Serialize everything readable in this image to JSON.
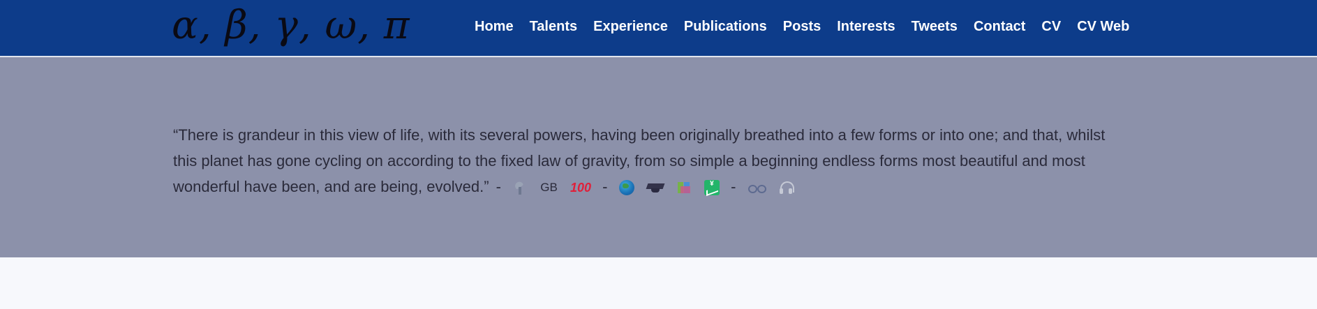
{
  "site": {
    "brand": "α, β, γ, ω, π"
  },
  "nav": {
    "items": [
      {
        "label": "Home"
      },
      {
        "label": "Talents"
      },
      {
        "label": "Experience"
      },
      {
        "label": "Publications"
      },
      {
        "label": "Posts"
      },
      {
        "label": "Interests"
      },
      {
        "label": "Tweets"
      },
      {
        "label": "Contact"
      },
      {
        "label": "CV"
      },
      {
        "label": "CV Web"
      }
    ]
  },
  "hero": {
    "quote": "“There is grandeur in this view of life, with its several powers, having been originally breathed into a few forms or into one; and that, whilst this planet has gone cycling on according to the fixed law of gravity, from so simple a beginning endless forms most beautiful and most wonderful have been, and are being, evolved.”",
    "separator": "-",
    "badge_gb": "GB",
    "badge_100": "100",
    "icons": [
      "microscope-icon",
      "gb-flag-icon",
      "hundred-points-icon",
      "globe-icon",
      "graduation-cap-icon",
      "books-icon",
      "chart-yen-icon",
      "glasses-icon",
      "headphones-icon"
    ]
  },
  "colors": {
    "navbar_bg": "#0d3c8a",
    "hero_bg": "#8c91aa",
    "page_bg": "#f7f8fc",
    "nav_text": "#ffffff"
  }
}
